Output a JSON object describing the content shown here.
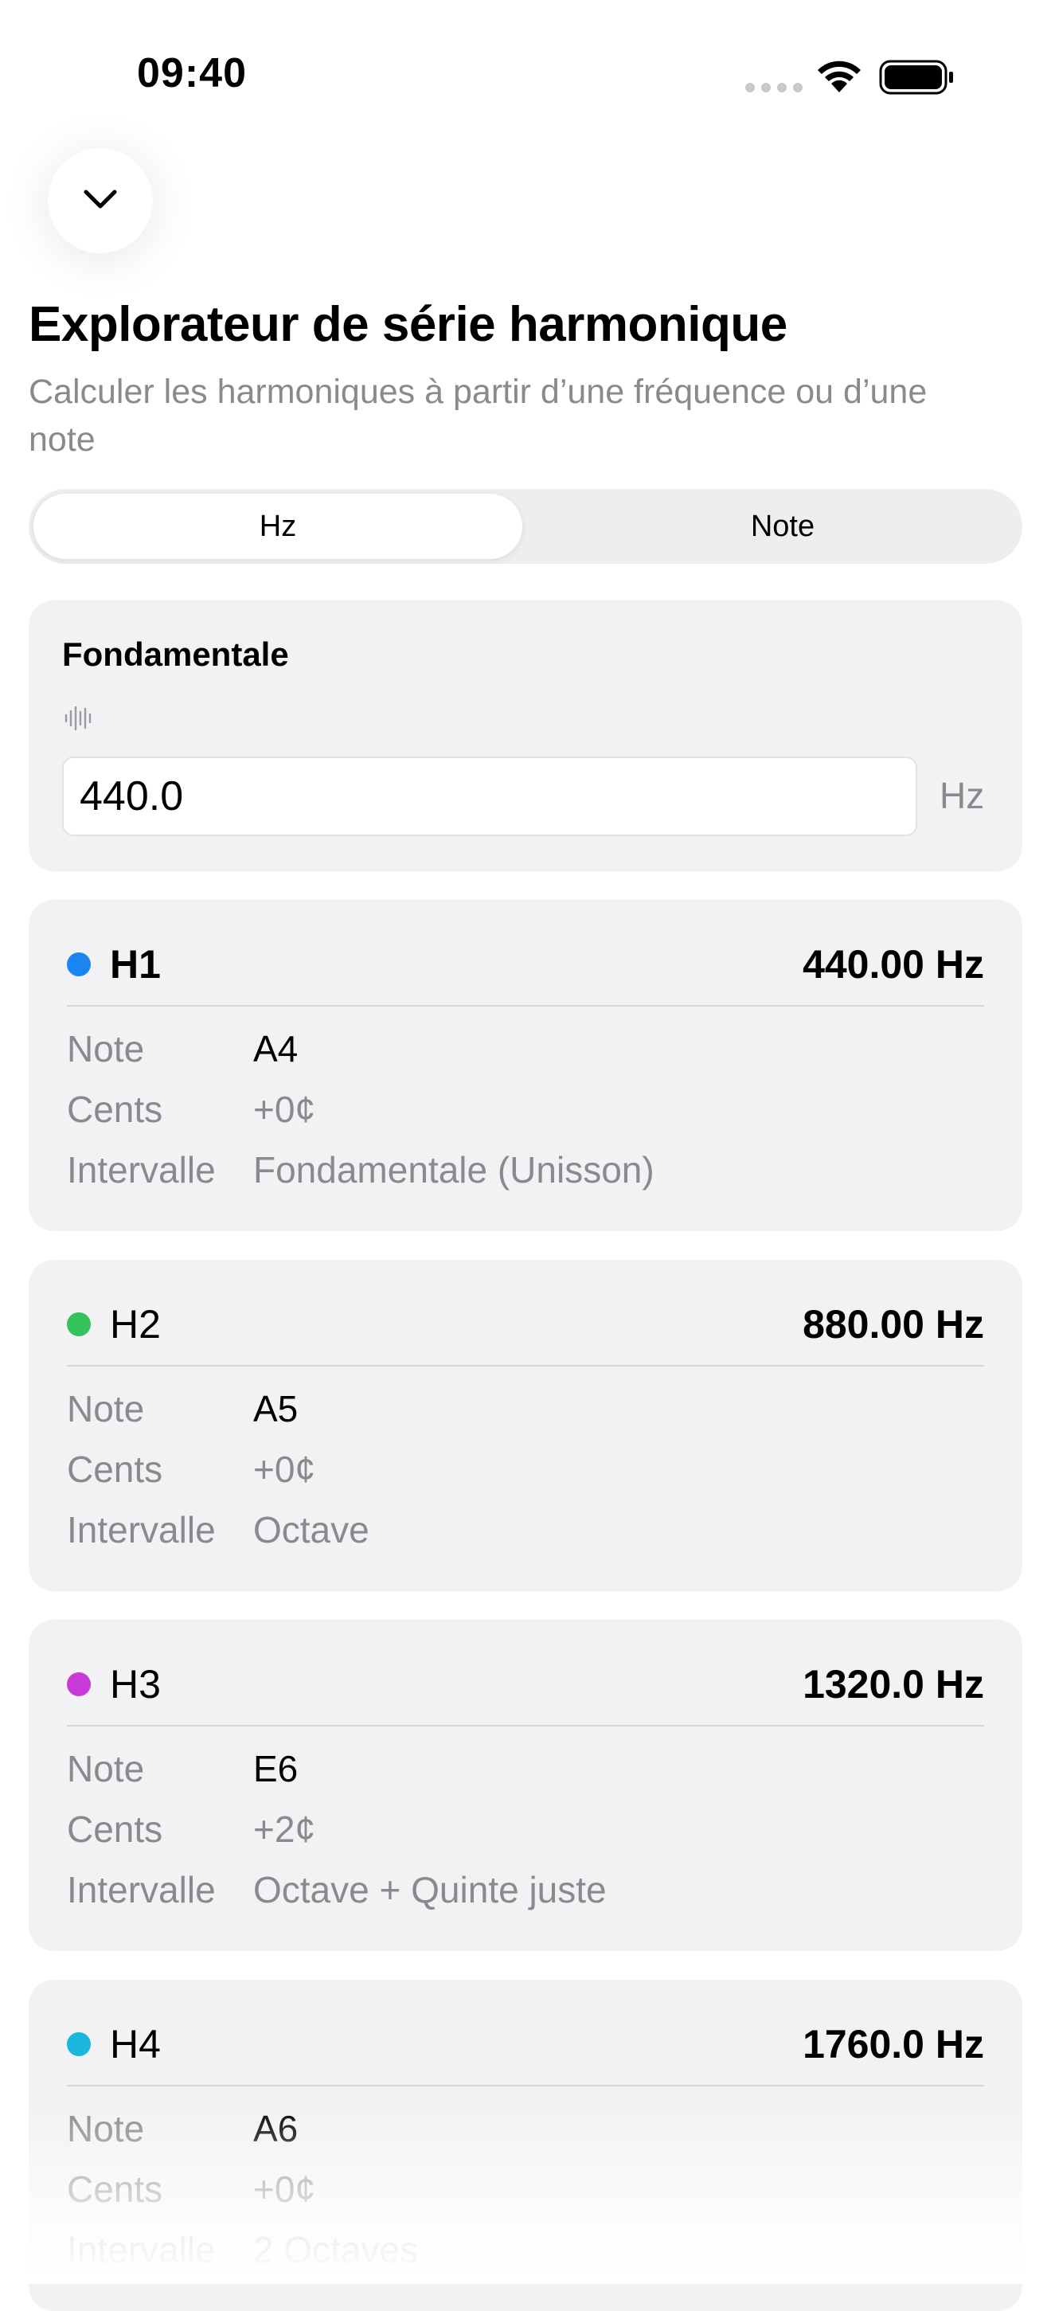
{
  "status_bar": {
    "time": "09:40"
  },
  "header": {
    "title": "Explorateur de série harmonique",
    "subtitle": "Calculer les harmoniques à partir d’une fréquence ou d’une note"
  },
  "mode_selector": {
    "options": [
      "Hz",
      "Note"
    ],
    "selected": "Hz"
  },
  "fundamental": {
    "label": "Fondamentale",
    "value": "440.0",
    "unit": "Hz"
  },
  "row_labels": {
    "note": "Note",
    "cents": "Cents",
    "interval": "Intervalle"
  },
  "harmonics": [
    {
      "label": "H1",
      "frequency": "440.00 Hz",
      "note": "A4",
      "cents": "+0¢",
      "interval": "Fondamentale (Unisson)",
      "color": "#1a84f0"
    },
    {
      "label": "H2",
      "frequency": "880.00 Hz",
      "note": "A5",
      "cents": "+0¢",
      "interval": "Octave",
      "color": "#34c25a"
    },
    {
      "label": "H3",
      "frequency": "1320.0 Hz",
      "note": "E6",
      "cents": "+2¢",
      "interval": "Octave + Quinte juste",
      "color": "#c83ad6"
    },
    {
      "label": "H4",
      "frequency": "1760.0 Hz",
      "note": "A6",
      "cents": "+0¢",
      "interval": "2 Octaves",
      "color": "#1ab6dc"
    }
  ],
  "icons": {
    "collapse": "chevron-down-icon",
    "wave": "waveform-icon"
  }
}
